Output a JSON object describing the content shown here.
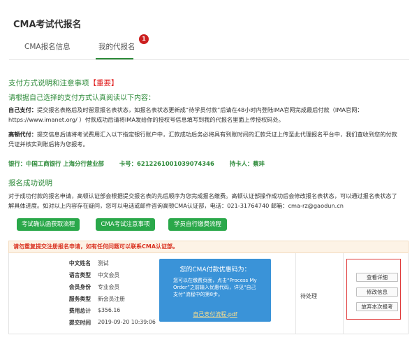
{
  "page_title": "CMA考试代报名",
  "tabs": [
    {
      "label": "CMA报名信息",
      "active": false
    },
    {
      "label": "我的代报名",
      "active": true,
      "badge": "1"
    }
  ],
  "payment_section": {
    "title": "支付方式说明和注意事项",
    "title_important": "【重要】",
    "hint": "请根据自己选择的支付方式认真阅读以下内容：",
    "self_pay_label": "自己支付：",
    "self_pay_text": "提交报名表格后及时留意报名表状态，如报名表状态更新成“待学员付款”后请在48小时内登陆IMA官网完成最后付款（IMA官网：https://www.imanet.org/ ）付款成功后请将IMA发给你的授权号信息填写到我的代报名里面上传授权码处。",
    "agency_pay_label": "高顿代付：",
    "agency_pay_text": "提交信息后请将考试费用汇入以下指定银行账户中，汇款成功后务必将具有到账时间的汇款凭证上传至此代理报名平台中，我们查收到您的付款凭证并核实到账后将为您报考。",
    "bank": {
      "bank_name": "银行：中国工商银行 上海分行营业部",
      "card_no": "卡号：6212261001039074346",
      "holder": "持卡人：蔡玤"
    }
  },
  "success_section": {
    "title": "报名成功说明",
    "text": "对于成功付款的报名申请，高顿认证部会根据提交报名表的先后顺序为您完成报名缴费。高顿认证部操作成功后会修改报名表状态，可以通过报名表状态了解具体进度。如对以上内容存在疑问，您可以电话或邮件咨询高顿CMA认证部，电话：021-31764740 邮箱：cma-rz@gaodun.cn"
  },
  "link_buttons": [
    "考试确认函获取流程",
    "CMA考试注意事项",
    "学员自行缴费流程"
  ],
  "warning": "请勿重复提交注册报名申请，如有任何问题可以联系CMA认证部。",
  "registration": {
    "fields": [
      {
        "label": "中文姓名",
        "value": "测试"
      },
      {
        "label": "语言类型",
        "value": "中文会员"
      },
      {
        "label": "会员身份",
        "value": "专业会员"
      },
      {
        "label": "服务类型",
        "value": "新会员注册"
      },
      {
        "label": "费用总计",
        "value": "$356.16"
      },
      {
        "label": "提交时间",
        "value": "2019-09-20 10:39:06"
      }
    ],
    "pay_card": {
      "title": "您的CMA付款优惠码为：",
      "text": "您可以在缴费页面，点击“Process My Order”之前输入优惠代码，详见“自己支付”流程中的第8步。",
      "link": "自己支付流程.pdf"
    },
    "status": "待处理",
    "actions": [
      "查看详细",
      "修改信息",
      "放弃本次报考"
    ]
  },
  "colors": {
    "accent_green": "#2e8b3a",
    "button_green": "#2aa84a",
    "important_red": "#e02020",
    "card_blue": "#3a93d8"
  }
}
